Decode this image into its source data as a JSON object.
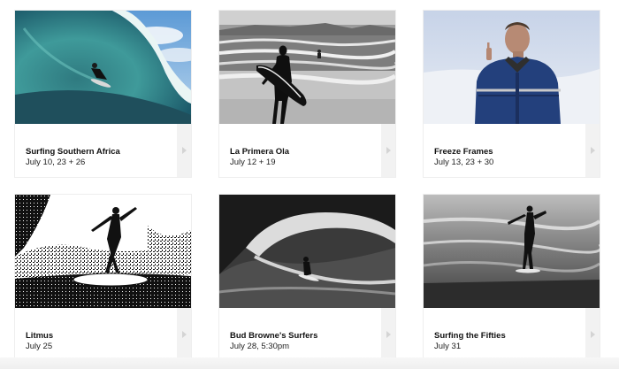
{
  "films": [
    {
      "title": "Surfing Southern Africa",
      "dates": "July 10, 23 + 26",
      "image": "barrel-wave-surfer"
    },
    {
      "title": "La Primera Ola",
      "dates": "July 12 + 19",
      "image": "surfer-silhouette-beach"
    },
    {
      "title": "Freeze Frames",
      "dates": "July 13, 23 + 30",
      "image": "man-in-snow"
    },
    {
      "title": "Litmus",
      "dates": "July 25",
      "image": "high-contrast-surfer"
    },
    {
      "title": "Bud Browne's Surfers",
      "dates": "July 28, 5:30pm",
      "image": "big-wave-surfer"
    },
    {
      "title": "Surfing the Fifties",
      "dates": "July 31",
      "image": "vintage-longboard-surfer"
    }
  ],
  "icons": {
    "arrow": "chevron-right-icon"
  },
  "colors": {
    "arrow_bg": "#f2f2f2",
    "arrow_icon": "#d4d4d4"
  }
}
